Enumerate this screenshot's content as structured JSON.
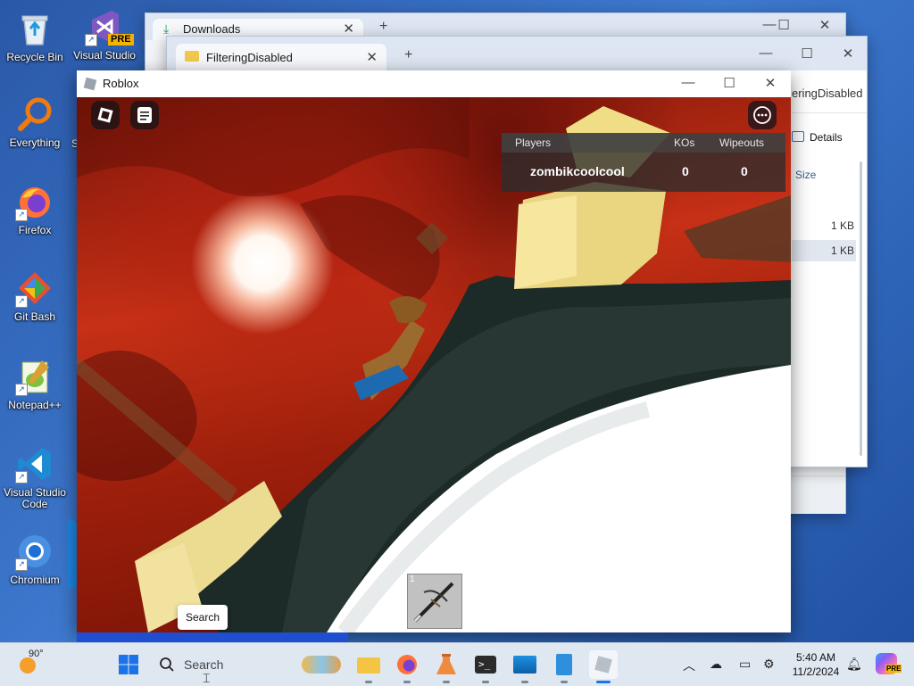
{
  "desktop": {
    "icons": [
      {
        "label": "Recycle Bin"
      },
      {
        "label": "Visual Studio",
        "badge": "PRE"
      },
      {
        "label": "Everything"
      },
      {
        "label": "Firefox"
      },
      {
        "label": "Git Bash"
      },
      {
        "label": "Notepad++"
      },
      {
        "label": "Visual Studio Code"
      },
      {
        "label": "Chromium"
      }
    ]
  },
  "downloads_window": {
    "tab_label": "Downloads"
  },
  "explorer_window": {
    "tab_label": "FilteringDisabled",
    "address_tail": "eringDisabled",
    "details_label": "Details",
    "column_size": "Size",
    "rows": [
      {
        "size": "1 KB"
      },
      {
        "size": "1 KB"
      }
    ]
  },
  "roblox": {
    "title": "Roblox",
    "leaderboard": {
      "headers": {
        "players": "Players",
        "kos": "KOs",
        "wipeouts": "Wipeouts"
      },
      "rows": [
        {
          "name": "zombikcoolcool",
          "kos": "0",
          "wipeouts": "0"
        }
      ]
    },
    "hotbar": {
      "slot_number": "1"
    },
    "search_tooltip": "Search"
  },
  "taskbar": {
    "weather": "90°",
    "search_placeholder": "Search",
    "time": "5:40 AM",
    "date": "11/2/2024"
  },
  "colors": {
    "taskbar_bg": "#dfe7f1",
    "roblox_sky": "#c63016",
    "leaderboard_bg": "#2d2d2d"
  }
}
